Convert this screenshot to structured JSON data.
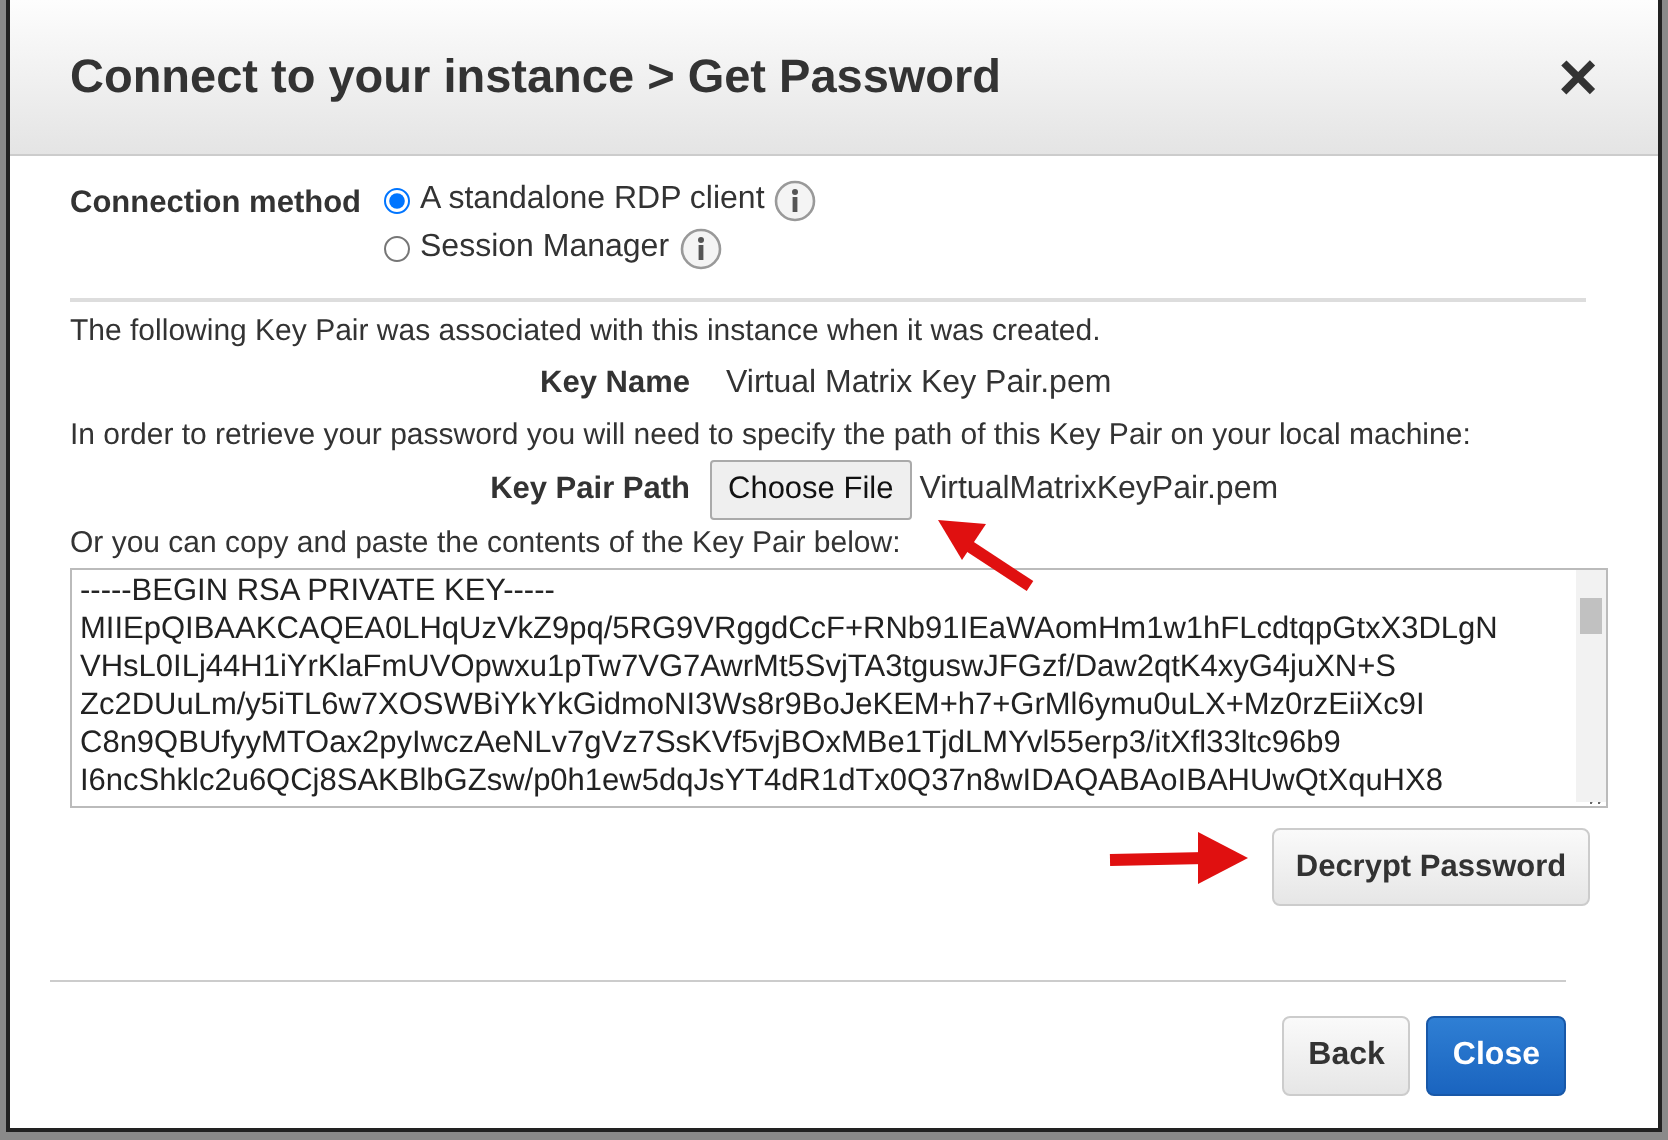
{
  "dialog": {
    "title": "Connect to your instance > Get Password",
    "close_glyph": "×"
  },
  "connection_method": {
    "label": "Connection method",
    "options": [
      {
        "label": "A standalone RDP client",
        "selected": true
      },
      {
        "label": "Session Manager",
        "selected": false
      }
    ]
  },
  "intro": "The following Key Pair was associated with this instance when it was created.",
  "key_name": {
    "label": "Key Name",
    "value": "Virtual Matrix Key Pair.pem"
  },
  "instructions": "In order to retrieve your password you will need to specify the path of this Key Pair on your local machine:",
  "key_pair_path": {
    "label": "Key Pair Path",
    "button": "Choose File",
    "file": "VirtualMatrixKeyPair.pem"
  },
  "paste_hint": "Or you can copy and paste the contents of the Key Pair below:",
  "key_contents": "-----BEGIN RSA PRIVATE KEY-----\nMIIEpQIBAAKCAQEA0LHqUzVkZ9pq/5RG9VRggdCcF+RNb91IEaWAomHm1w1hFLcdtqpGtxX3DLgN\nVHsL0ILj44H1iYrKlaFmUVOpwxu1pTw7VG7AwrMt5SvjTA3tguswJFGzf/Daw2qtK4xyG4juXN+S\nZc2DUuLm/y5iTL6w7XOSWBiYkYkGidmoNI3Ws8r9BoJeKEM+h7+GrMl6ymu0uLX+Mz0rzEiiXc9I\nC8n9QBUfyyMTOax2pyIwczAeNLv7gVz7SsKVf5vjBOxMBe1TjdLMYvl55erp3/itXfl33ltc96b9\nI6ncShklc2u6QCj8SAKBlbGZsw/p0h1ew5dqJsYT4dR1dTx0Q37n8wIDAQABAoIBAHUwQtXquHX8",
  "decrypt_button": "Decrypt Password",
  "footer_buttons": [
    {
      "label": "Back",
      "kind": "secondary"
    },
    {
      "label": "Close",
      "kind": "primary"
    }
  ]
}
